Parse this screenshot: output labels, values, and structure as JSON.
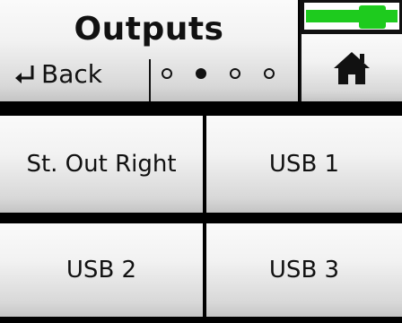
{
  "header": {
    "title": "Outputs",
    "back_label": "Back",
    "page_indicator": {
      "total": 4,
      "current": 2
    }
  },
  "status": {
    "level_fraction": 0.8,
    "level_color": "#1ecb1e"
  },
  "home": {
    "icon": "home-icon"
  },
  "buttons": [
    {
      "label": "St. Out Right"
    },
    {
      "label": "USB 1"
    },
    {
      "label": "USB 2"
    },
    {
      "label": "USB 3"
    }
  ]
}
